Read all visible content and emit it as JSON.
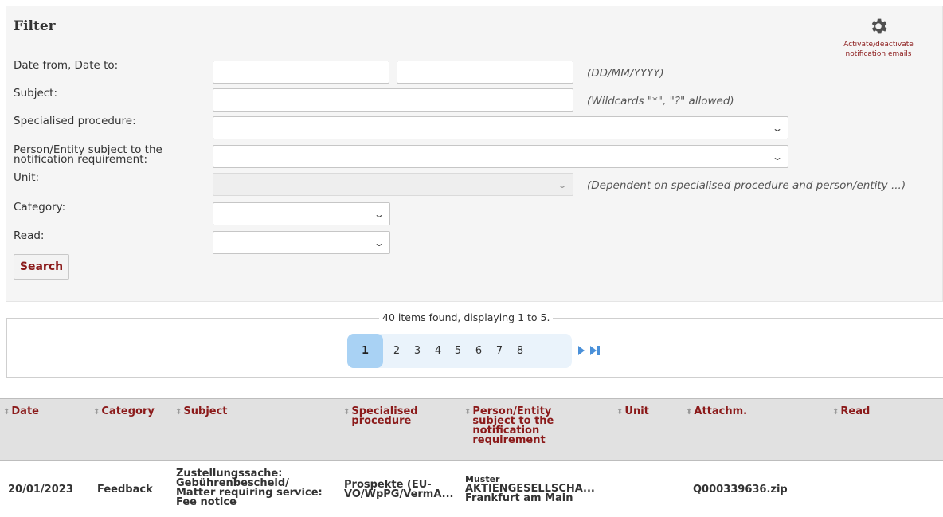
{
  "filter": {
    "title": "Filter",
    "labels": {
      "date": "Date from, Date to:",
      "subject": "Subject:",
      "procedure": "Specialised procedure:",
      "person_line1": "Person/Entity subject to the",
      "person_line2": "notification requirement:",
      "unit": "Unit:",
      "category": "Category:",
      "read": "Read:"
    },
    "values": {
      "date_from": "",
      "date_to": "",
      "subject": "",
      "procedure": "",
      "person": "",
      "unit": "",
      "category": "",
      "read": ""
    },
    "hints": {
      "date": "(DD/MM/YYYY)",
      "subject": "(Wildcards \"*\", \"?\" allowed)",
      "unit": "(Dependent on specialised procedure and person/entity ...)"
    },
    "search_label": "Search",
    "notifications": {
      "icon": "gear-icon",
      "line1": "Activate/deactivate",
      "line2": "notification emails"
    }
  },
  "pagination": {
    "summary": "40 items found, displaying 1 to 5.",
    "current": "1",
    "pages": [
      "2",
      "3",
      "4",
      "5",
      "6",
      "7",
      "8"
    ],
    "next_icon": "next-page-icon",
    "last_icon": "last-page-icon"
  },
  "table": {
    "headers": {
      "date": "Date",
      "category": "Category",
      "subject": "Subject",
      "procedure_l1": "Specialised",
      "procedure_l2": "procedure",
      "person_l1": "Person/Entity",
      "person_l2": "subject to the",
      "person_l3": "notification",
      "person_l4": "requirement",
      "unit": "Unit",
      "attachment": "Attachm.",
      "read": "Read"
    },
    "sort_icon": "⬍",
    "rows": [
      {
        "date": "20/01/2023",
        "category": "Feedback",
        "subject_l1": "Zustellungssache:",
        "subject_l2": "Gebührenbescheid/",
        "subject_l3": "Matter requiring service:",
        "subject_l4": "Fee notice",
        "procedure_l1": "Prospekte (EU-",
        "procedure_l2": "VO/WpPG/VermA...",
        "person_l1": "Muster",
        "person_l2": "AKTIENGESELLSCHA...",
        "person_l3": "Frankfurt am Main",
        "unit": "",
        "attachment": "Q000339636.zip",
        "read": ""
      }
    ]
  },
  "colors": {
    "accent": "#8b1a1a",
    "panel": "#f5f5f5",
    "pager_strip": "#eaf3fb",
    "pager_current": "#a9d2f4",
    "nav_icon": "#4a90d9",
    "table_header": "#e1e1e1"
  }
}
